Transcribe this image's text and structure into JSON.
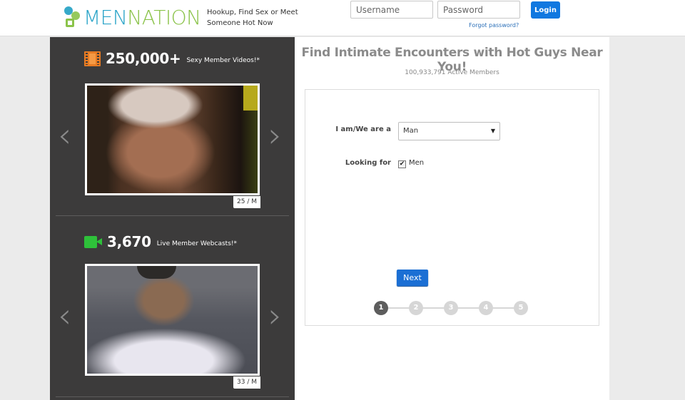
{
  "header": {
    "logo": "MENNATION",
    "logo_part1": "MEN",
    "logo_part2": "NATION",
    "tagline": "Hookup, Find Sex or Meet Someone Hot Now",
    "username_placeholder": "Username",
    "password_placeholder": "Password",
    "login_label": "Login",
    "forgot_label": "Forgot password?"
  },
  "left_panel": {
    "videos": {
      "icon": "film-icon",
      "count": "250,000+",
      "label": "Sexy Member Videos!*",
      "badge": "25 / M"
    },
    "webcams": {
      "icon": "webcam-icon",
      "count": "3,670",
      "label": "Live Member Webcasts!*",
      "badge": "33 / M"
    },
    "arrow_left": "‹",
    "arrow_right": "›"
  },
  "main": {
    "headline": "Find Intimate Encounters with Hot Guys Near You!",
    "active_members": "100,933,791 Active Members",
    "form": {
      "iam_label": "I am/We are a",
      "iam_value": "Man",
      "looking_label": "Looking for",
      "looking_option": "Men",
      "looking_checked": true,
      "next_label": "Next",
      "steps": [
        "1",
        "2",
        "3",
        "4",
        "5"
      ],
      "current_step": 1
    }
  },
  "colors": {
    "brand_blue": "#1178e0",
    "logo_teal": "#2aa4c8",
    "logo_green": "#8bc34a",
    "panel_dark": "#3c3b3b",
    "film_orange": "#e87b22",
    "webcam_green": "#2ec13a"
  }
}
